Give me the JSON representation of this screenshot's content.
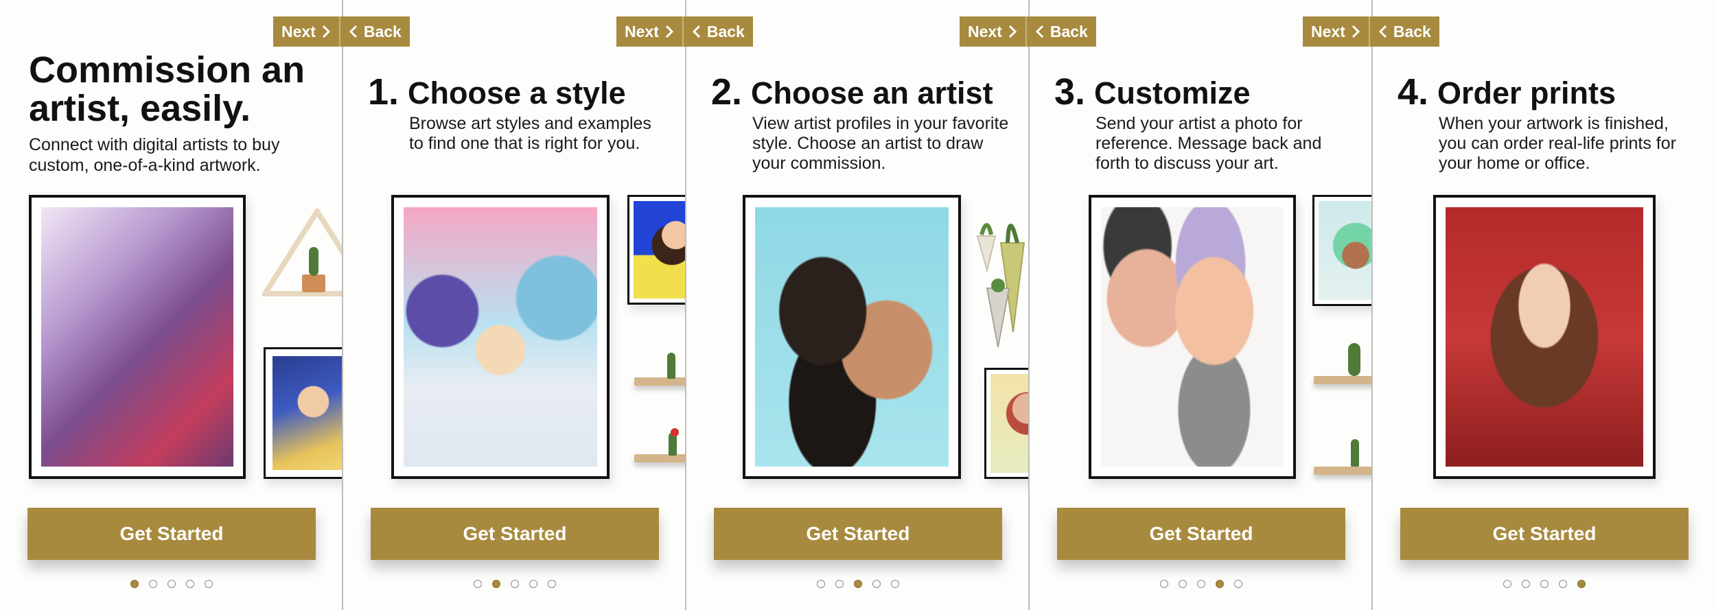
{
  "nav": {
    "next_label": "Next",
    "back_label": "Back"
  },
  "intro": {
    "title": "Commission an artist, easily.",
    "subtitle": "Connect with digital artists to buy custom, one-of-a-kind artwork."
  },
  "steps": [
    {
      "number": "1.",
      "title": "Choose a style",
      "description": "Browse art styles and examples to find one that is right for you."
    },
    {
      "number": "2.",
      "title": "Choose an artist",
      "description": "View artist profiles in your favorite style. Choose an artist to draw your commission."
    },
    {
      "number": "3.",
      "title": "Customize",
      "description": "Send your artist a photo for reference. Message back and forth to discuss your art."
    },
    {
      "number": "4.",
      "title": "Order prints",
      "description": "When your artwork is finished, you can order real-life prints for your home or office."
    }
  ],
  "cta_label": "Get Started",
  "pagination": {
    "total": 5
  },
  "colors": {
    "accent": "#a88a3f",
    "text": "#111111",
    "frame": "#111111",
    "divider": "#bdbdbd"
  }
}
